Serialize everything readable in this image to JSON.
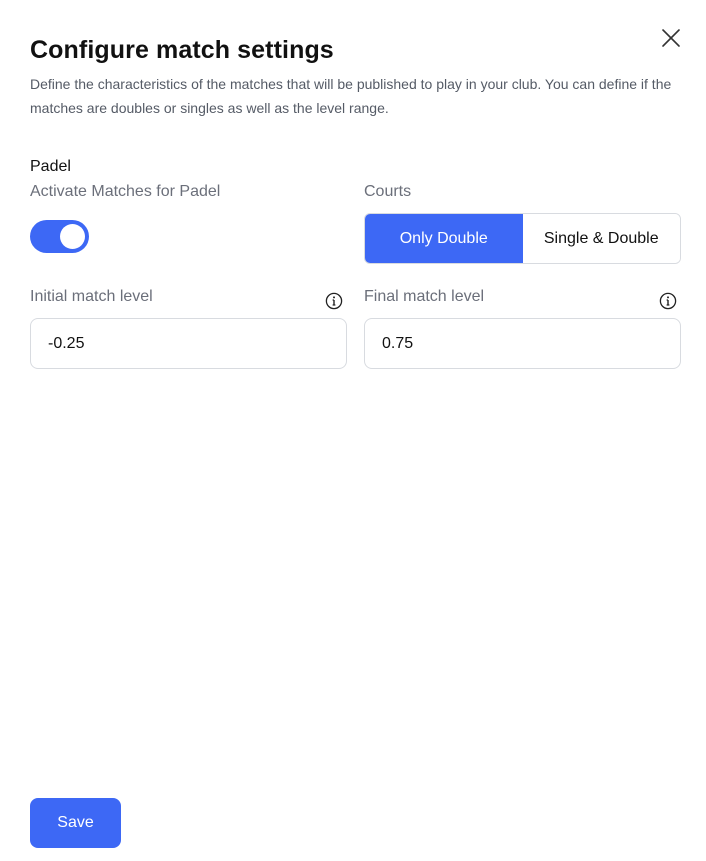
{
  "dialog": {
    "title": "Configure match settings",
    "description": "Define the characteristics of the matches that will be published to play in your club. You can define if the matches are doubles or singles as well as the level range.",
    "close_icon": "close-icon"
  },
  "sport": {
    "name": "Padel",
    "activate_label": "Activate Matches for Padel",
    "activate_enabled": true
  },
  "courts": {
    "label": "Courts",
    "options": [
      "Only Double",
      "Single & Double"
    ],
    "selected": "Only Double"
  },
  "levels": {
    "initial_label": "Initial match level",
    "initial_value": "-0.25",
    "final_label": "Final match level",
    "final_value": "0.75",
    "info_icon": "info-icon"
  },
  "footer": {
    "save_label": "Save"
  },
  "colors": {
    "accent": "#3d68f5",
    "title": "#111111",
    "muted": "#6b6f7a",
    "border": "#d8dbe0"
  }
}
